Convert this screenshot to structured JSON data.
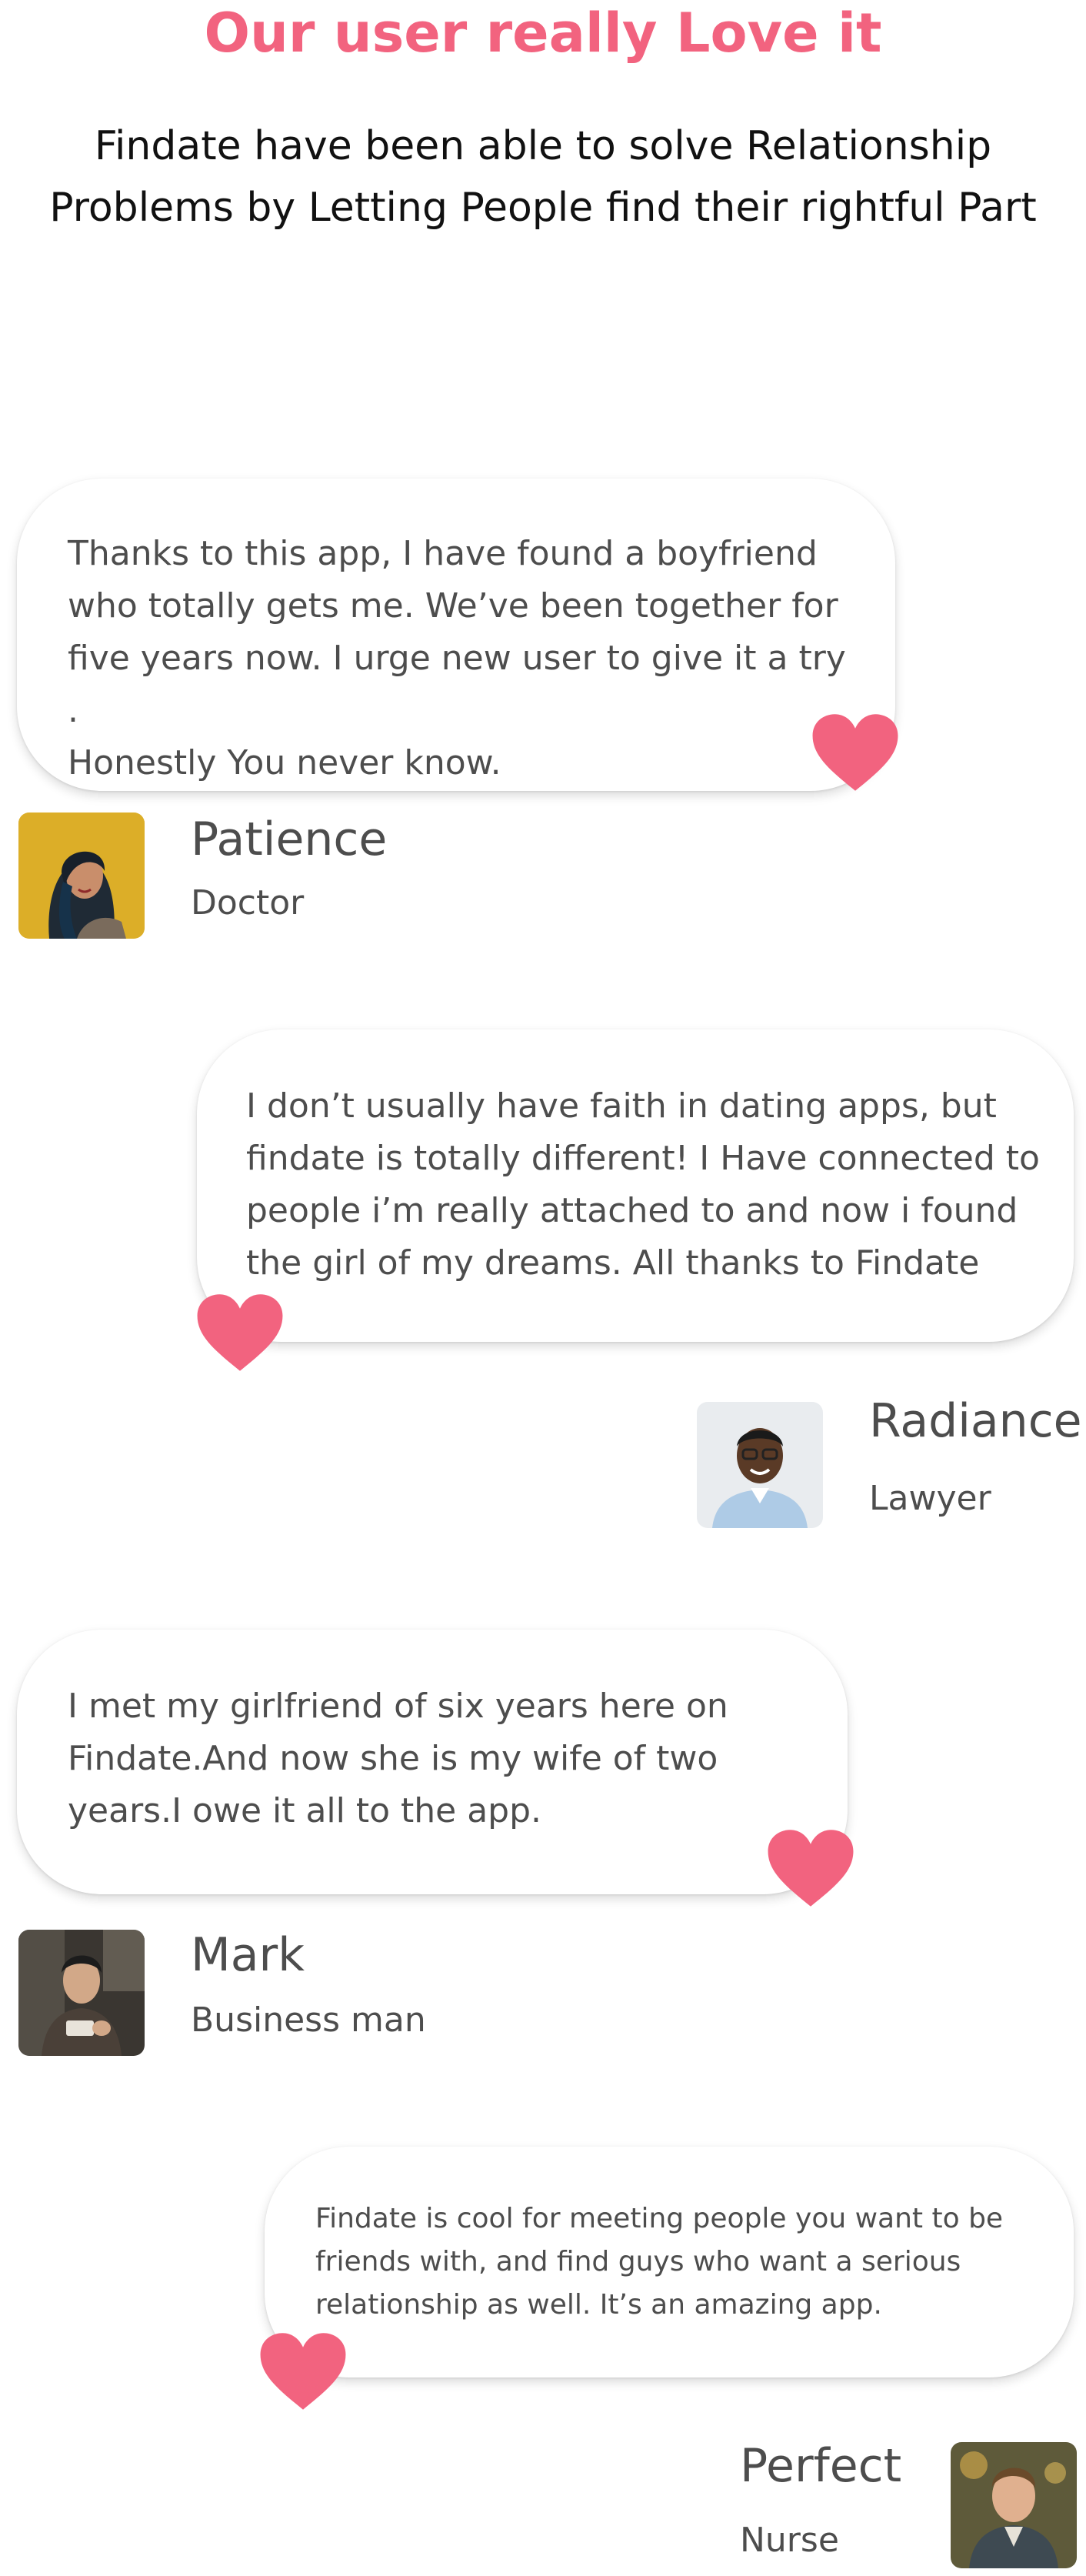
{
  "header": {
    "title": "Our user really Love it",
    "subtitle_line1": "Findate have been able to solve Relationship",
    "subtitle_line2": "Problems by Letting People find their rightful Part"
  },
  "colors": {
    "accent": "#f2637f",
    "text": "#4d4d4d",
    "heading_text": "#111111",
    "bubble_bg": "#ffffff"
  },
  "testimonials": [
    {
      "lines": [
        "Thanks to this app, I have found a boyfriend",
        "who totally gets me. We’ve been together for",
        "five years now. I urge new user to give it a try .",
        "Honestly You never know."
      ],
      "name": "Patience",
      "role": "Doctor",
      "icon": "heart-icon"
    },
    {
      "lines": [
        "I don’t usually have faith in dating apps, but",
        "findate is totally different!  I Have connected to",
        "people i’m really attached to and now i found",
        "the girl of my dreams. All thanks to Findate"
      ],
      "name": "Radiance",
      "role": "Lawyer",
      "icon": "heart-icon"
    },
    {
      "lines": [
        "I met my girlfriend of six years here on",
        "Findate.And now she is my wife of two",
        "years.I owe it all to the app."
      ],
      "name": "Mark",
      "role": "Business man",
      "icon": "heart-icon"
    },
    {
      "lines": [
        "Findate is cool for meeting people you want to be",
        "friends with, and find guys who want a serious",
        "relationship as well. It’s an amazing app."
      ],
      "name": "Perfect",
      "role": "Nurse",
      "icon": "heart-icon"
    }
  ]
}
